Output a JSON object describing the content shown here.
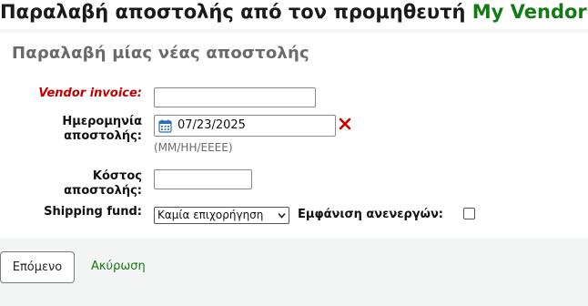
{
  "page": {
    "heading_prefix": "Παραλαβή αποστολής από τον προμηθευτή ",
    "vendor_name": "My Vendor"
  },
  "section": {
    "title": "Παραλαβή μίας νέας αποστολής"
  },
  "form": {
    "vendor_invoice_label": "Vendor invoice:",
    "vendor_invoice_value": "",
    "shipment_date_label_line1": "Ημερομηνία",
    "shipment_date_label_line2": "αποστολής:",
    "shipment_date_value": "07/23/2025",
    "shipment_date_hint": "(MM/HH/EEEE)",
    "shipping_cost_label_line1": "Κόστος",
    "shipping_cost_label_line2": "αποστολής:",
    "shipping_cost_value": "",
    "shipping_fund_label": "Shipping fund:",
    "shipping_fund_selected": "Καμία επιχορήγηση",
    "show_inactive_label": "Εμφάνιση ανενεργών:",
    "show_inactive_checked": false
  },
  "actions": {
    "next_label": "Επόμενο",
    "cancel_label": "Ακύρωση"
  },
  "colors": {
    "link_green": "#147a14",
    "required_red": "#c00000",
    "clear_red": "#cc0000",
    "calendar_blue": "#2a6ab8"
  }
}
